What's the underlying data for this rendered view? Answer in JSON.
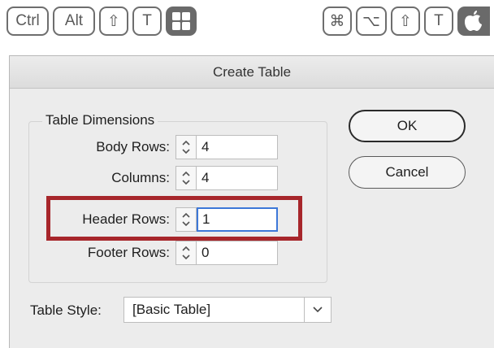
{
  "shortcuts": {
    "windows": [
      "Ctrl",
      "Alt",
      "⇧",
      "T"
    ],
    "mac": [
      "⌘",
      "⌥",
      "⇧",
      "T"
    ]
  },
  "dialog": {
    "title": "Create Table",
    "group_title": "Table Dimensions",
    "fields": {
      "body_rows": {
        "label": "Body Rows:",
        "value": "4"
      },
      "columns": {
        "label": "Columns:",
        "value": "4"
      },
      "header_rows": {
        "label": "Header Rows:",
        "value": "1"
      },
      "footer_rows": {
        "label": "Footer Rows:",
        "value": "0"
      }
    },
    "buttons": {
      "ok": "OK",
      "cancel": "Cancel"
    },
    "table_style": {
      "label": "Table Style:",
      "value": "[Basic Table]"
    }
  },
  "colors": {
    "highlight": "#a7262b",
    "focus": "#3d78d8",
    "dialog_bg": "#ececec"
  }
}
